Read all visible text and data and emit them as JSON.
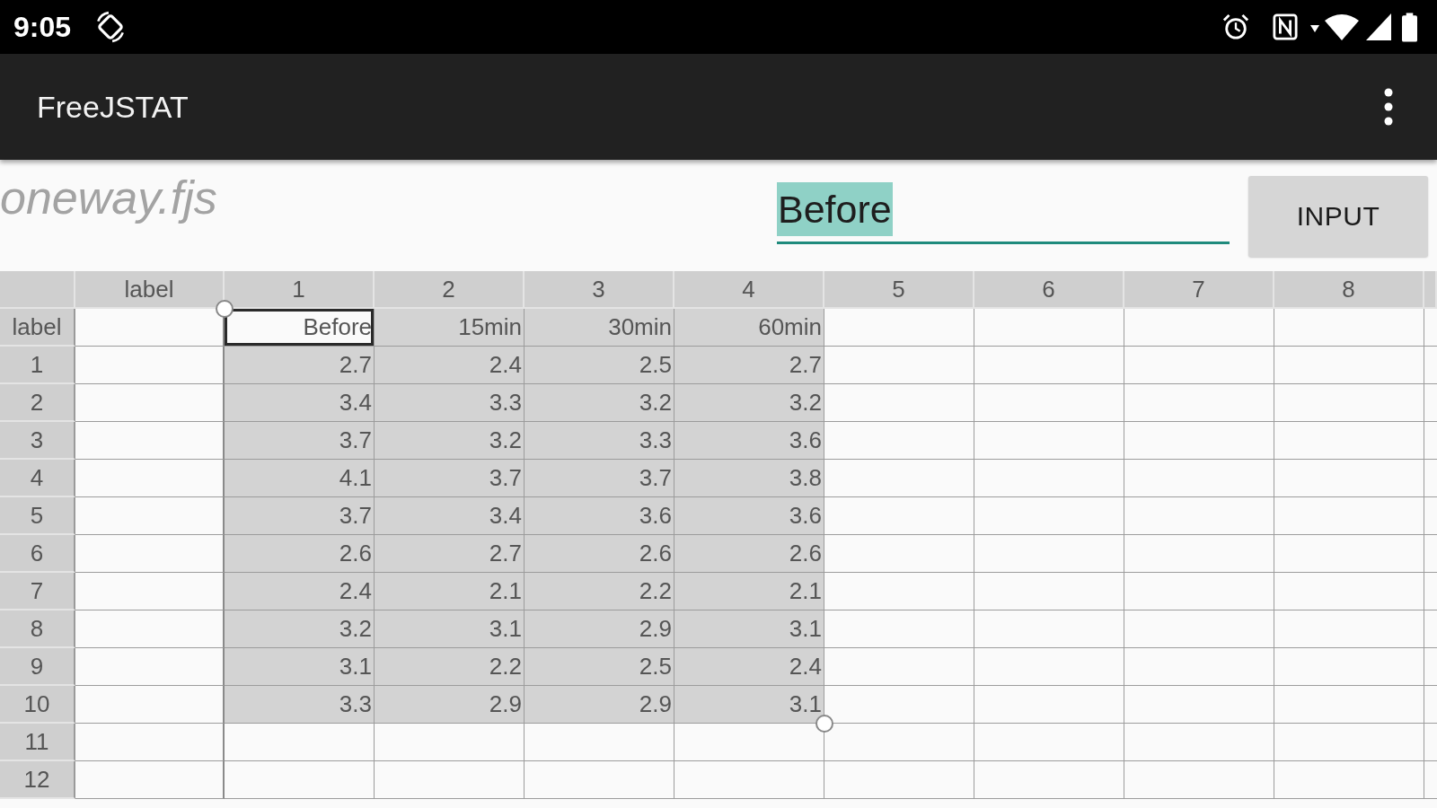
{
  "status_bar": {
    "time": "9:05"
  },
  "app_bar": {
    "title": "FreeJSTAT"
  },
  "file_name": "oneway.fjs",
  "cell_editor": {
    "value": "Before",
    "text_selected": true
  },
  "input_button": {
    "label": "INPUT"
  },
  "sheet": {
    "columns": [
      "label",
      "1",
      "2",
      "3",
      "4",
      "5",
      "6",
      "7",
      "8"
    ],
    "rows": [
      {
        "header": "label",
        "cells": [
          {
            "text": "Before",
            "selected": false,
            "current": true
          },
          {
            "text": "15min",
            "selected": true,
            "current": false
          },
          {
            "text": "30min",
            "selected": true,
            "current": false
          },
          {
            "text": "60min",
            "selected": true,
            "current": false
          }
        ]
      },
      {
        "header": "1",
        "cells": [
          {
            "text": "2.7",
            "selected": true,
            "current": false
          },
          {
            "text": "2.4",
            "selected": true,
            "current": false
          },
          {
            "text": "2.5",
            "selected": true,
            "current": false
          },
          {
            "text": "2.7",
            "selected": true,
            "current": false
          }
        ]
      },
      {
        "header": "2",
        "cells": [
          {
            "text": "3.4",
            "selected": true,
            "current": false
          },
          {
            "text": "3.3",
            "selected": true,
            "current": false
          },
          {
            "text": "3.2",
            "selected": true,
            "current": false
          },
          {
            "text": "3.2",
            "selected": true,
            "current": false
          }
        ]
      },
      {
        "header": "3",
        "cells": [
          {
            "text": "3.7",
            "selected": true,
            "current": false
          },
          {
            "text": "3.2",
            "selected": true,
            "current": false
          },
          {
            "text": "3.3",
            "selected": true,
            "current": false
          },
          {
            "text": "3.6",
            "selected": true,
            "current": false
          }
        ]
      },
      {
        "header": "4",
        "cells": [
          {
            "text": "4.1",
            "selected": true,
            "current": false
          },
          {
            "text": "3.7",
            "selected": true,
            "current": false
          },
          {
            "text": "3.7",
            "selected": true,
            "current": false
          },
          {
            "text": "3.8",
            "selected": true,
            "current": false
          }
        ]
      },
      {
        "header": "5",
        "cells": [
          {
            "text": "3.7",
            "selected": true,
            "current": false
          },
          {
            "text": "3.4",
            "selected": true,
            "current": false
          },
          {
            "text": "3.6",
            "selected": true,
            "current": false
          },
          {
            "text": "3.6",
            "selected": true,
            "current": false
          }
        ]
      },
      {
        "header": "6",
        "cells": [
          {
            "text": "2.6",
            "selected": true,
            "current": false
          },
          {
            "text": "2.7",
            "selected": true,
            "current": false
          },
          {
            "text": "2.6",
            "selected": true,
            "current": false
          },
          {
            "text": "2.6",
            "selected": true,
            "current": false
          }
        ]
      },
      {
        "header": "7",
        "cells": [
          {
            "text": "2.4",
            "selected": true,
            "current": false
          },
          {
            "text": "2.1",
            "selected": true,
            "current": false
          },
          {
            "text": "2.2",
            "selected": true,
            "current": false
          },
          {
            "text": "2.1",
            "selected": true,
            "current": false
          }
        ]
      },
      {
        "header": "8",
        "cells": [
          {
            "text": "3.2",
            "selected": true,
            "current": false
          },
          {
            "text": "3.1",
            "selected": true,
            "current": false
          },
          {
            "text": "2.9",
            "selected": true,
            "current": false
          },
          {
            "text": "3.1",
            "selected": true,
            "current": false
          }
        ]
      },
      {
        "header": "9",
        "cells": [
          {
            "text": "3.1",
            "selected": true,
            "current": false
          },
          {
            "text": "2.2",
            "selected": true,
            "current": false
          },
          {
            "text": "2.5",
            "selected": true,
            "current": false
          },
          {
            "text": "2.4",
            "selected": true,
            "current": false
          }
        ]
      },
      {
        "header": "10",
        "cells": [
          {
            "text": "3.3",
            "selected": true,
            "current": false
          },
          {
            "text": "2.9",
            "selected": true,
            "current": false
          },
          {
            "text": "2.9",
            "selected": true,
            "current": false
          },
          {
            "text": "3.1",
            "selected": true,
            "current": false
          }
        ]
      },
      {
        "header": "11"
      },
      {
        "header": "12"
      }
    ]
  }
}
